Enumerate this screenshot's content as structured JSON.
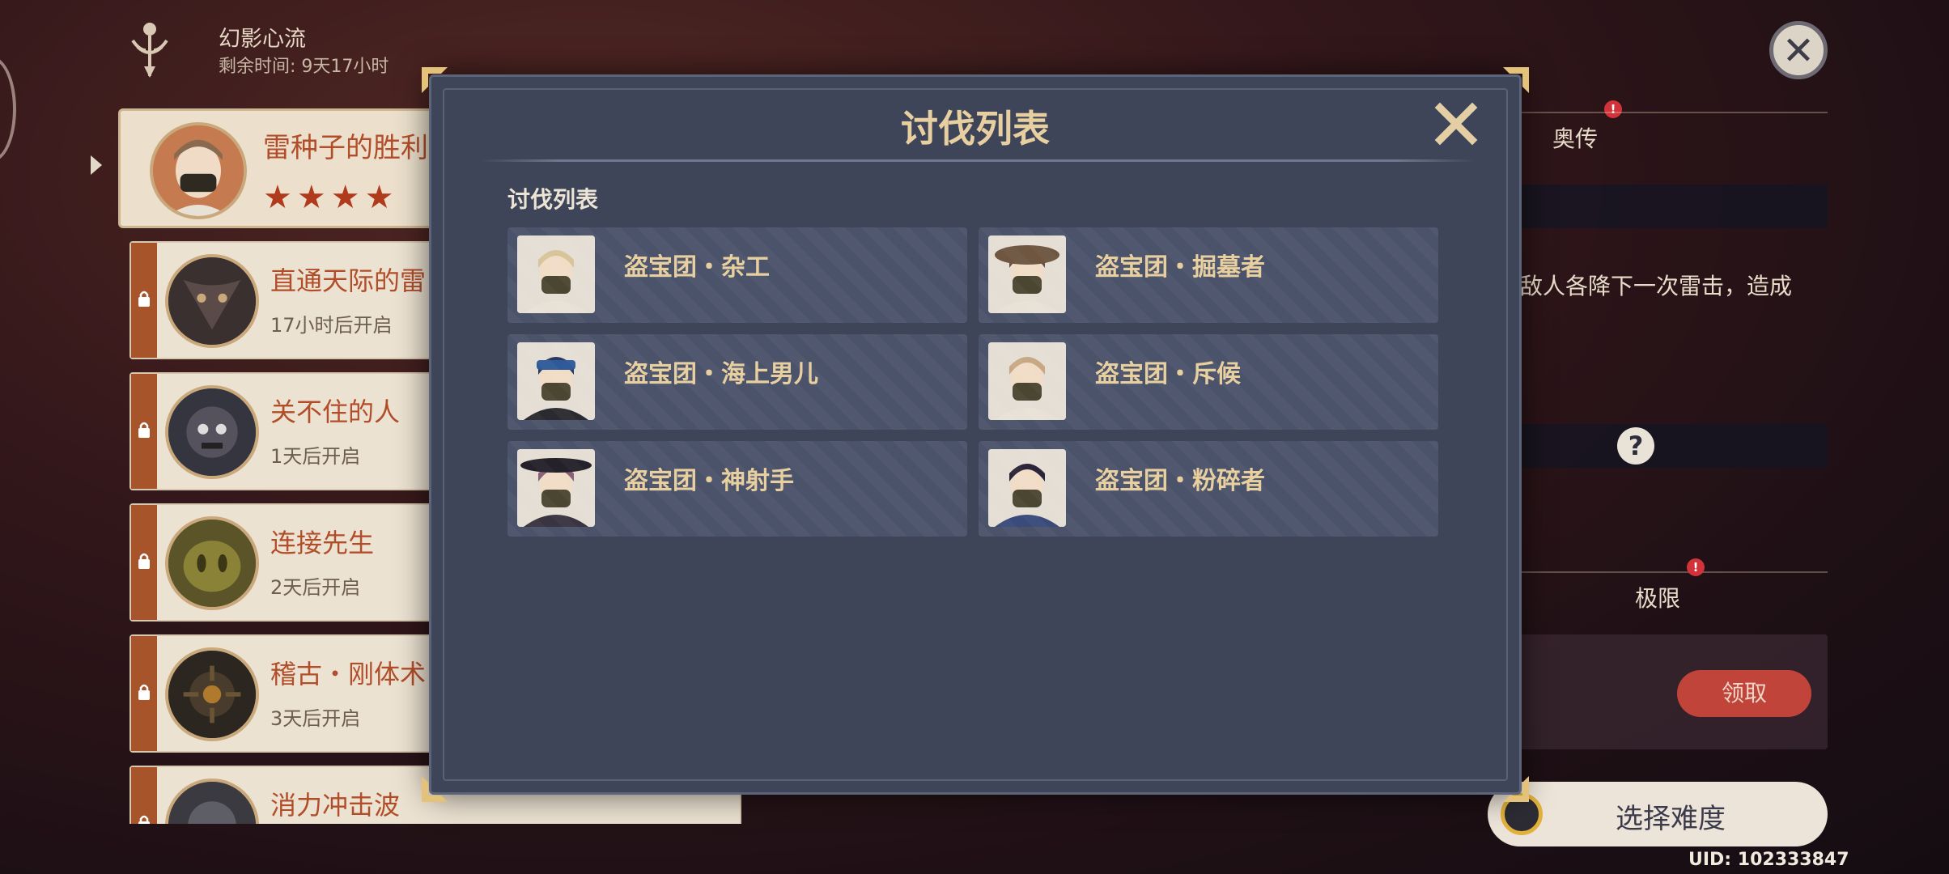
{
  "event": {
    "title": "幻影心流",
    "time_left": "剩余时间: 9天17小时"
  },
  "challenges": [
    {
      "name": "雷种子的胜利",
      "stars": "★★★★",
      "status": ""
    },
    {
      "name": "直通天际的雷",
      "status": "17小时后开启"
    },
    {
      "name": "关不住的人",
      "status": "1天后开启"
    },
    {
      "name": "连接先生",
      "status": "2天后开启"
    },
    {
      "name": "稽古・刚体术",
      "status": "3天后开启"
    },
    {
      "name": "消力冲击波",
      "status": ""
    }
  ],
  "right_panel": {
    "tab_legend": "奥传",
    "description": "敌人各降下一次雷击，造成",
    "tab_limit": "极限",
    "claim_label": "领取",
    "choose_difficulty": "选择难度",
    "uid": "UID: 102333847",
    "help_glyph": "?",
    "notif_glyph": "!"
  },
  "modal": {
    "title": "讨伐列表",
    "section_label": "讨伐列表",
    "enemies": [
      {
        "name": "盗宝团・杂工",
        "hair": "#d8c49a",
        "hat": "none",
        "cloth": "#e8e2d6"
      },
      {
        "name": "盗宝团・掘墓者",
        "hair": "#6a5040",
        "hat": "straw",
        "cloth": "#e8e2d6"
      },
      {
        "name": "盗宝团・海上男儿",
        "hair": "#2a3a5a",
        "hat": "bandana",
        "cloth": "#2a2a30"
      },
      {
        "name": "盗宝团・斥候",
        "hair": "#c8a884",
        "hat": "none",
        "cloth": "#e8e2d6"
      },
      {
        "name": "盗宝团・神射手",
        "hair": "#8a6078",
        "hat": "wide",
        "cloth": "#3a3340"
      },
      {
        "name": "盗宝团・粉碎者",
        "hair": "#2c2438",
        "hat": "none",
        "cloth": "#3a4a7a"
      }
    ]
  },
  "colors": {
    "accent_gold": "#e8cfa0",
    "title_red": "#b24d2a",
    "lock_bar": "#a8542a",
    "modal_bg": "#3e4559"
  }
}
